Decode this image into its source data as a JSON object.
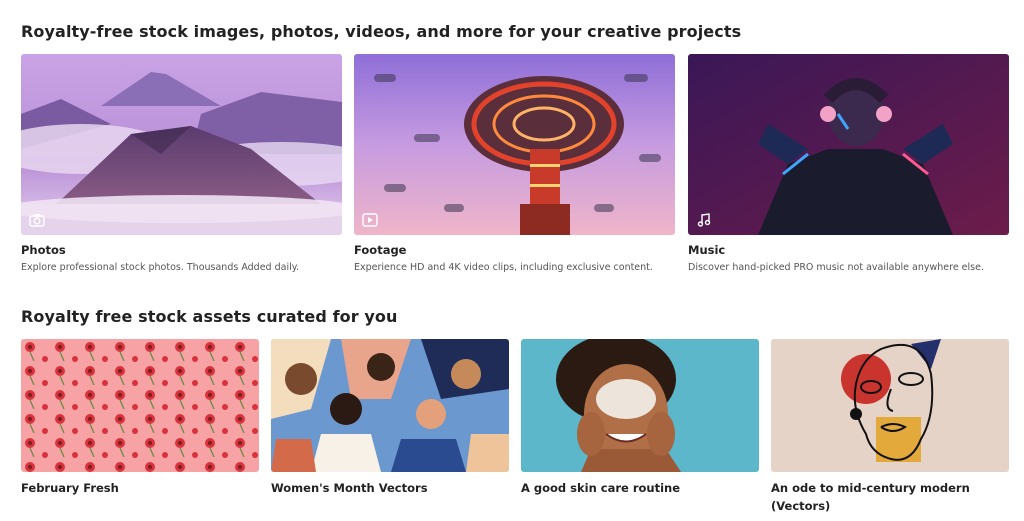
{
  "sections": {
    "categories_title": "Royalty-free stock images, photos, videos, and more for your creative projects",
    "curated_title": "Royalty free stock assets curated for you"
  },
  "categories": [
    {
      "title": "Photos",
      "description": "Explore professional stock photos. Thousands Added daily.",
      "icon": "camera-icon"
    },
    {
      "title": "Footage",
      "description": "Experience HD and 4K video clips, including exclusive content.",
      "icon": "play-icon"
    },
    {
      "title": "Music",
      "description": "Discover hand-picked PRO music not available anywhere else.",
      "icon": "music-note-icon"
    }
  ],
  "collections": [
    {
      "title": "February Fresh"
    },
    {
      "title": "Women's Month Vectors"
    },
    {
      "title": "A good skin care routine"
    },
    {
      "title": "An ode to mid-century modern (Vectors)"
    }
  ],
  "colors": {
    "heading": "#222222",
    "description": "#555555",
    "background": "#ffffff"
  }
}
